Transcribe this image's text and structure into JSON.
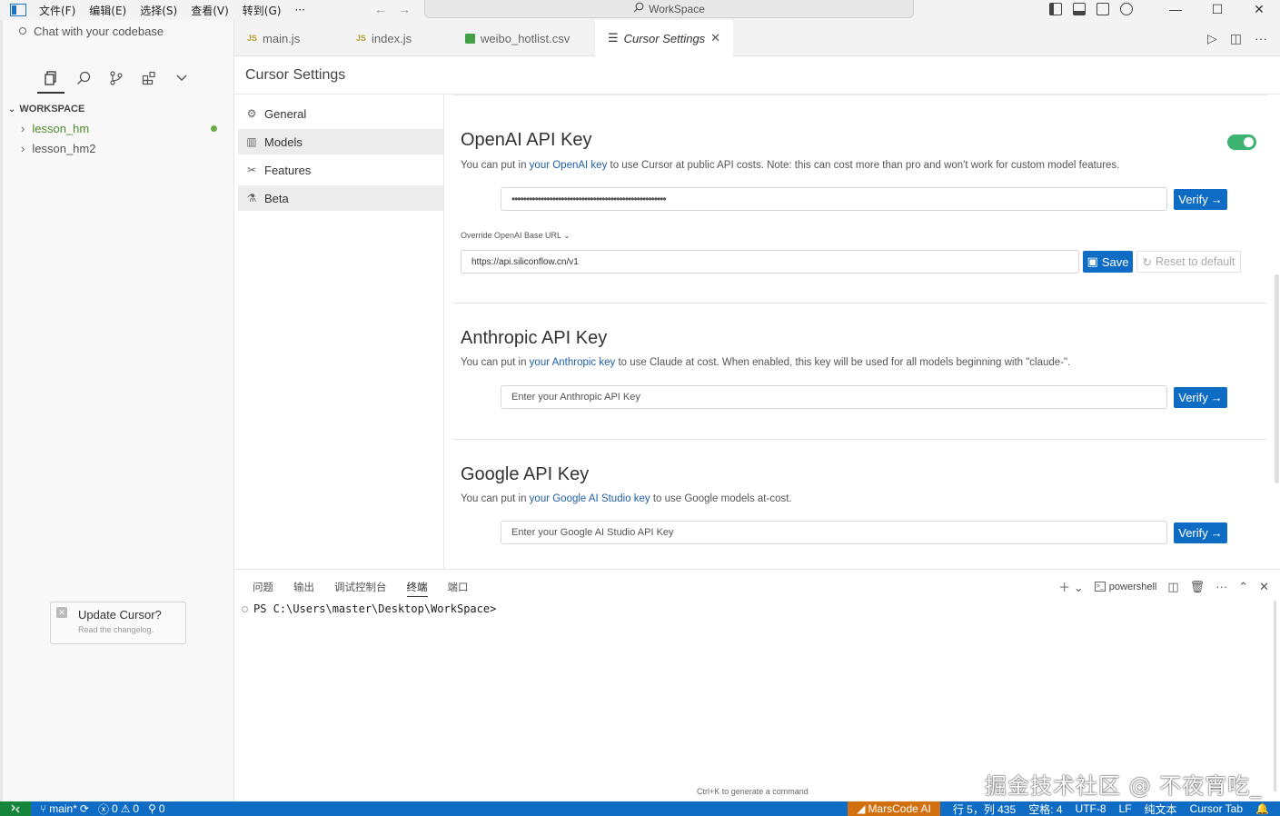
{
  "titlebar": {
    "menus": [
      "文件(F)",
      "编辑(E)",
      "选择(S)",
      "查看(V)",
      "转到(G)",
      "···"
    ],
    "search_label": "WorkSpace",
    "back_icon": "arrow-left-icon",
    "forward_icon": "arrow-right-icon"
  },
  "sidebar": {
    "chat_label": "Chat with your codebase",
    "workspace_header": "WORKSPACE",
    "folders": [
      {
        "label": "lesson_hm",
        "modified": true
      },
      {
        "label": "lesson_hm2",
        "modified": false
      }
    ],
    "update": {
      "title": "Update Cursor?",
      "subtitle": "Read the changelog."
    }
  },
  "tabs": [
    {
      "label": "main.js",
      "icon": "JS"
    },
    {
      "label": "index.js",
      "icon": "JS"
    },
    {
      "label": "weibo_hotlist.csv",
      "icon": "csv"
    },
    {
      "label": "Cursor Settings",
      "icon": "settings-list",
      "active": true
    }
  ],
  "settings": {
    "title": "Cursor Settings",
    "nav": [
      {
        "label": "General",
        "icon": "gear-icon"
      },
      {
        "label": "Models",
        "icon": "chart-icon",
        "selected": true
      },
      {
        "label": "Features",
        "icon": "tools-icon"
      },
      {
        "label": "Beta",
        "icon": "flask-icon"
      }
    ],
    "openai": {
      "title": "OpenAI API Key",
      "desc_pre": "You can put in ",
      "desc_link": "your OpenAI key",
      "desc_post": " to use Cursor at public API costs. Note: this can cost more than pro and won't work for custom model features.",
      "key_value": "•••••••••••••••••••••••••••••••••••••••••••••••••••••",
      "enabled": true,
      "verify_label": "Verify",
      "override_label": "Override OpenAI Base URL",
      "base_url": "https://api.siliconflow.cn/v1",
      "save_label": "Save",
      "reset_label": "Reset to default"
    },
    "anthropic": {
      "title": "Anthropic API Key",
      "desc_pre": "You can put in ",
      "desc_link": "your Anthropic key",
      "desc_post": " to use Claude at cost. When enabled, this key will be used for all models beginning with \"claude-\".",
      "placeholder": "Enter your Anthropic API Key",
      "verify_label": "Verify"
    },
    "google": {
      "title": "Google API Key",
      "desc_pre": "You can put in ",
      "desc_link": "your Google AI Studio key",
      "desc_post": " to use Google models at-cost.",
      "placeholder": "Enter your Google AI Studio API Key",
      "verify_label": "Verify"
    }
  },
  "panel": {
    "tabs": [
      "问题",
      "输出",
      "调试控制台",
      "终端",
      "端口"
    ],
    "active_tab": "终端",
    "shell_label": "powershell",
    "prompt": "PS C:\\Users\\master\\Desktop\\WorkSpace>",
    "hint": "Ctrl+K to generate a command",
    "watermark": "掘金技术社区 @ 不夜宵吃_"
  },
  "statusbar": {
    "branch": "main*",
    "errors": "0",
    "warnings": "0",
    "ports": "0",
    "marscode": "MarsCode AI",
    "position": "行 5，列 435",
    "spaces": "空格: 4",
    "encoding": "UTF-8",
    "eol": "LF",
    "language": "纯文本",
    "cursor_tab": "Cursor Tab"
  }
}
